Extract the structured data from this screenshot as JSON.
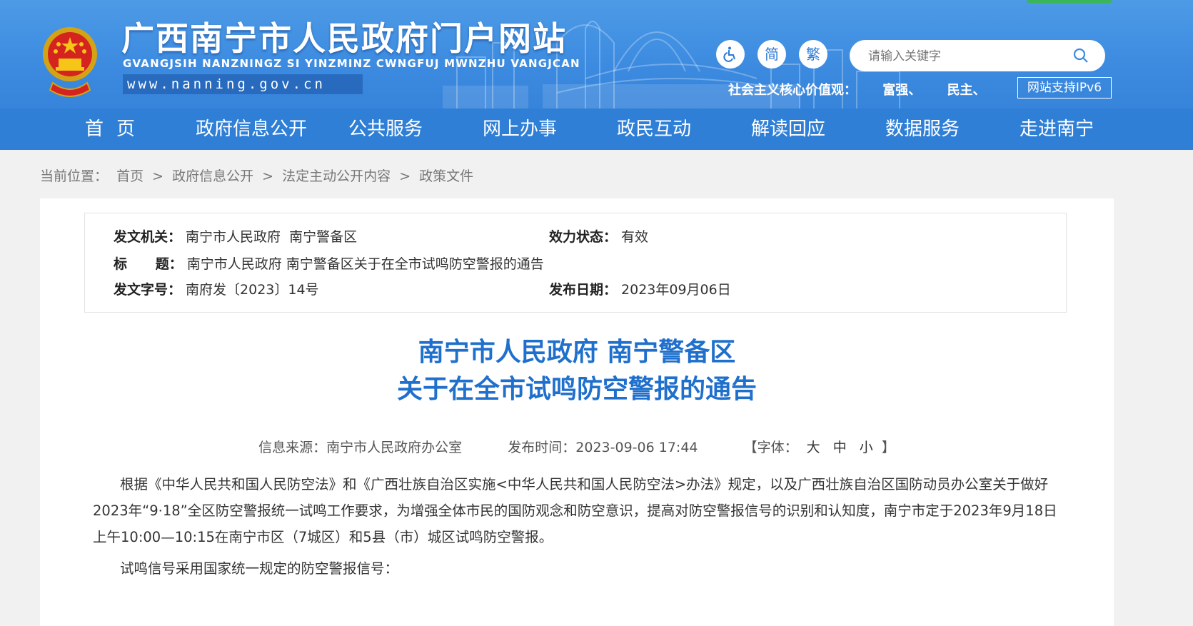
{
  "header": {
    "site_title": "广西南宁市人民政府门户网站",
    "site_subtitle": "GVANGJSIH NANZNINGZ SI YINZMINZ CWNGFUJ MWNZHU VANGJCAN",
    "site_url": "www.nanning.gov.cn",
    "accessibility_icon": "wheelchair-icon",
    "simplified_label": "简",
    "traditional_label": "繁",
    "search_placeholder": "请输入关键字",
    "core_values_label": "社会主义核心价值观：",
    "core_values": [
      "富强、",
      "民主、"
    ],
    "ipv6_label": "网站支持IPv6",
    "brand_color": "#3c8be0",
    "nav_color": "#2f7fd6"
  },
  "nav": {
    "items": [
      "首页",
      "政府信息公开",
      "公共服务",
      "网上办事",
      "政民互动",
      "解读回应",
      "数据服务",
      "走进南宁"
    ]
  },
  "breadcrumb": {
    "label": "当前位置：",
    "items": [
      "首页",
      "政府信息公开",
      "法定主动公开内容",
      "政策文件"
    ],
    "separator": ">"
  },
  "meta": {
    "issuer_label": "发文机关：",
    "issuer": "南宁市人民政府  南宁警备区",
    "status_label": "效力状态：",
    "status": "有效",
    "title_label": "标      题：",
    "title": "南宁市人民政府 南宁警备区关于在全市试鸣防空警报的通告",
    "doc_no_label": "发文字号：",
    "doc_no": "南府发〔2023〕14号",
    "date_label": "发布日期：",
    "date": "2023年09月06日"
  },
  "article": {
    "title_line1": "南宁市人民政府 南宁警备区",
    "title_line2": "关于在全市试鸣防空警报的通告",
    "title_color": "#1f6fcc",
    "source_label": "信息来源：",
    "source": "南宁市人民政府办公室",
    "time_label": "发布时间：",
    "time": "2023-09-06 17:44",
    "font_label": "【字体：",
    "font_large": "大",
    "font_medium": "中",
    "font_small": "小",
    "font_close": "】",
    "paragraph1": "根据《中华人民共和国人民防空法》和《广西壮族自治区实施<中华人民共和国人民防空法>办法》规定，以及广西壮族自治区国防动员办公室关于做好2023年“9·18”全区防空警报统一试鸣工作要求，为增强全体市民的国防观念和防空意识，提高对防空警报信号的识别和认知度，南宁市定于2023年9月18日上午10:00—10:15在南宁市区（7城区）和5县（市）城区试鸣防空警报。",
    "paragraph2": "试鸣信号采用国家统一规定的防空警报信号："
  }
}
